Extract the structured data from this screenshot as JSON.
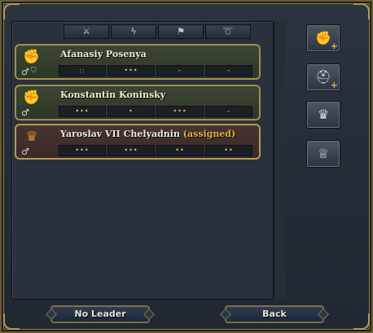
{
  "header": {
    "columns": [
      {
        "icon": "crossed-swords-icon",
        "glyph": "⚔"
      },
      {
        "icon": "lightning-icon",
        "glyph": "ϟ"
      },
      {
        "icon": "flag-star-icon",
        "glyph": "⚑"
      },
      {
        "icon": "horn-icon",
        "glyph": "➰"
      }
    ]
  },
  "leaders": [
    {
      "name": "Afanasiy Posenya",
      "assigned": "",
      "stats": [
        "::",
        "•••",
        "–",
        "–"
      ],
      "gender": "♂",
      "badge": "⛉",
      "icon": "gauntlet-icon"
    },
    {
      "name": "Konstantin Koninsky",
      "assigned": "",
      "stats": [
        "•••",
        "•",
        "•••",
        "–"
      ],
      "gender": "♂",
      "badge": "",
      "icon": "gauntlet-icon"
    },
    {
      "name": "Yaroslav VII Chelyadnin",
      "assigned": "(assigned)",
      "stats": [
        "•••",
        "•••",
        "••",
        "••"
      ],
      "gender": "♂",
      "badge": "",
      "icon": "crown-gauntlet-icon"
    }
  ],
  "side_buttons": [
    {
      "icon": "recruit-general-icon",
      "glyph": "✊",
      "plus": "+"
    },
    {
      "icon": "recruit-admiral-icon",
      "glyph": "⛑",
      "plus": "+"
    },
    {
      "icon": "ruler-leader-icon",
      "glyph": "♛",
      "plus": ""
    },
    {
      "icon": "heir-leader-icon",
      "glyph": "♕",
      "plus": ""
    }
  ],
  "footer": {
    "no_leader_label": "No Leader",
    "back_label": "Back"
  }
}
